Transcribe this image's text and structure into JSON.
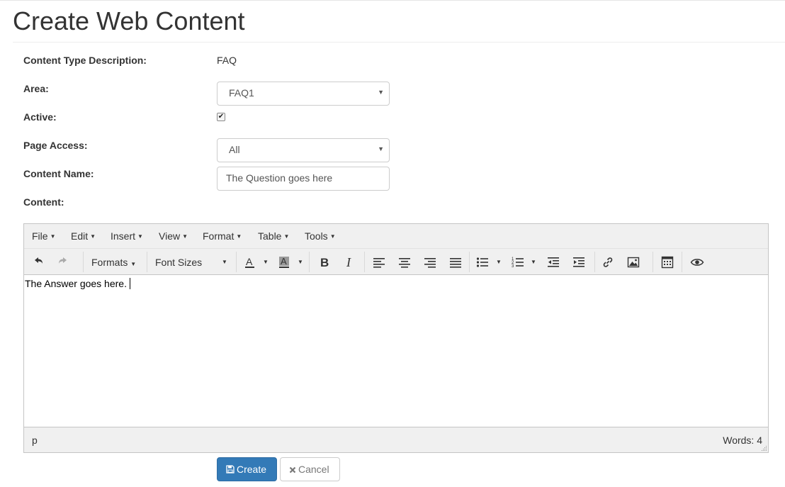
{
  "page": {
    "title": "Create Web Content"
  },
  "form": {
    "content_type_label": "Content Type Description:",
    "content_type_value": "FAQ",
    "area_label": "Area:",
    "area_value": "FAQ1",
    "active_label": "Active:",
    "active_checked": true,
    "page_access_label": "Page Access:",
    "page_access_value": "All",
    "content_name_label": "Content Name:",
    "content_name_value": "The Question goes here",
    "content_label": "Content:"
  },
  "editor": {
    "menus": [
      "File",
      "Edit",
      "Insert",
      "View",
      "Format",
      "Table",
      "Tools"
    ],
    "formats_label": "Formats",
    "font_sizes_label": "Font Sizes",
    "body_text": "The Answer goes here.",
    "path": "p",
    "word_count": "Words: 4",
    "icons": [
      "undo-icon",
      "redo-icon",
      "text-color-icon",
      "background-color-icon",
      "bold-icon",
      "italic-icon",
      "align-left-icon",
      "align-center-icon",
      "align-right-icon",
      "align-justify-icon",
      "bullet-list-icon",
      "numbered-list-icon",
      "outdent-icon",
      "indent-icon",
      "link-icon",
      "image-icon",
      "charmap-icon",
      "preview-icon"
    ]
  },
  "actions": {
    "create_label": "Create",
    "cancel_label": "Cancel"
  },
  "colors": {
    "primary": "#337ab7",
    "toolbar_bg": "#f0f0f0"
  }
}
